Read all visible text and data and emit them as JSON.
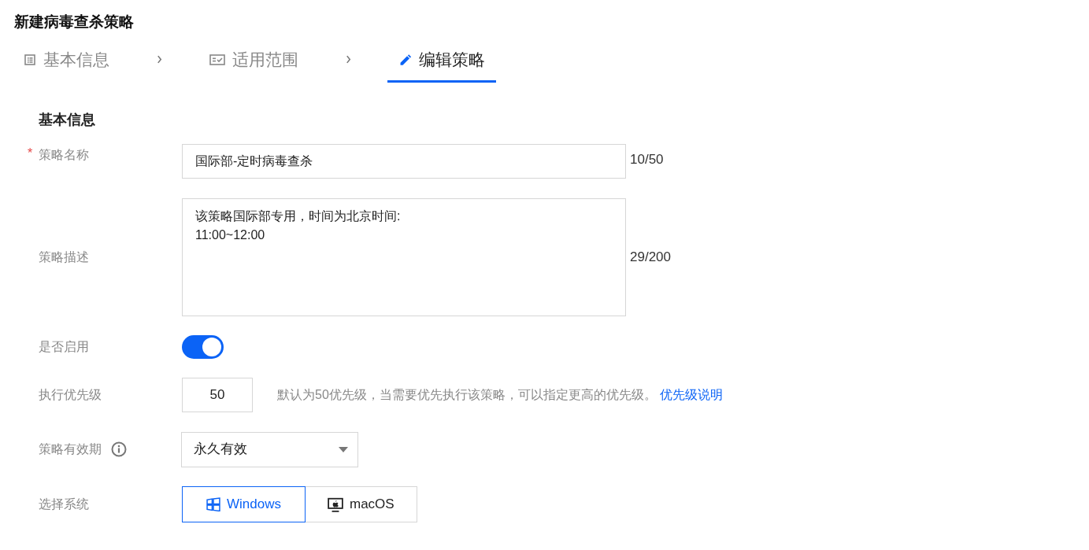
{
  "title": "新建病毒查杀策略",
  "steps": [
    {
      "label": "基本信息",
      "kind": "list",
      "selected": false
    },
    {
      "label": "适用范围",
      "kind": "checklist",
      "selected": false
    },
    {
      "label": "编辑策略",
      "kind": "edit",
      "selected": true
    }
  ],
  "section_title": "基本信息",
  "form": {
    "name": {
      "label": "策略名称",
      "required_mark": "*",
      "value": "国际部-定时病毒查杀",
      "counter": "10/50"
    },
    "description": {
      "label": "策略描述",
      "value": "该策略国际部专用，时间为北京时间:\n11:00~12:00",
      "counter": "29/200"
    },
    "enabled": {
      "label": "是否启用",
      "on": true
    },
    "priority": {
      "label": "执行优先级",
      "value": "50",
      "hint": "默认为50优先级，当需要优先执行该策略，可以指定更高的优先级。",
      "link": "优先级说明"
    },
    "validity": {
      "label": "策略有效期",
      "value": "永久有效"
    },
    "system": {
      "label": "选择系统",
      "options": [
        {
          "label": "Windows",
          "kind": "windows",
          "selected": true
        },
        {
          "label": "macOS",
          "kind": "mac",
          "selected": false
        }
      ]
    }
  }
}
